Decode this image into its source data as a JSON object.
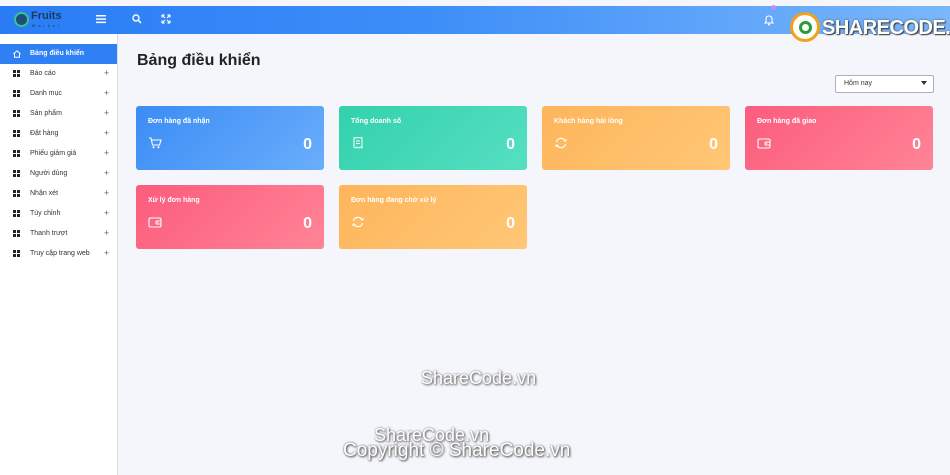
{
  "brand": {
    "name": "Fruits",
    "sub": "Market"
  },
  "header": {
    "menu_icon": "menu-icon",
    "search_icon": "search-icon",
    "fullscreen_icon": "expand-icon",
    "notification_icon": "bell-icon"
  },
  "watermark": {
    "logo_text": "SHARECODE.vn",
    "center_text": "ShareCode.vn",
    "copyright": "Copyright © ShareCode.vn"
  },
  "sidebar": {
    "items": [
      {
        "label": "Bảng điều khiển",
        "icon": "home-icon",
        "active": true
      },
      {
        "label": "Báo cáo",
        "icon": "grid-icon",
        "expand": "+"
      },
      {
        "label": "Danh mục",
        "icon": "grid-icon",
        "expand": "+"
      },
      {
        "label": "Sản phẩm",
        "icon": "grid-icon",
        "expand": "+"
      },
      {
        "label": "Đặt hàng",
        "icon": "grid-icon",
        "expand": "+"
      },
      {
        "label": "Phiếu giảm giá",
        "icon": "grid-icon",
        "expand": "+"
      },
      {
        "label": "Người dùng",
        "icon": "grid-icon",
        "expand": "+"
      },
      {
        "label": "Nhận xét",
        "icon": "grid-icon",
        "expand": "+"
      },
      {
        "label": "Tùy chỉnh",
        "icon": "grid-icon",
        "expand": "+"
      },
      {
        "label": "Thanh trượt",
        "icon": "grid-icon",
        "expand": "+"
      },
      {
        "label": "Truy cập trang web",
        "icon": "grid-icon",
        "expand": "+"
      }
    ]
  },
  "main": {
    "title": "Bảng điều khiển",
    "period_select": {
      "value": "Hôm nay"
    },
    "cards": [
      {
        "title": "Đơn hàng đã nhận",
        "value": "0",
        "icon": "cart-icon",
        "color": "#3b8cf5"
      },
      {
        "title": "Tổng doanh số",
        "value": "0",
        "icon": "receipt-icon",
        "color": "#33d1ad"
      },
      {
        "title": "Khách hàng hài lòng",
        "value": "0",
        "icon": "refresh-icon",
        "color": "#feb55b"
      },
      {
        "title": "Đơn hàng đã giao",
        "value": "0",
        "icon": "wallet-icon",
        "color": "#fc5c7d"
      },
      {
        "title": "Xử lý đơn hàng",
        "value": "0",
        "icon": "wallet-icon",
        "color": "#fc5c7d"
      },
      {
        "title": "Đơn hàng đang chờ xử lý",
        "value": "0",
        "icon": "refresh-icon",
        "color": "#feb55b"
      }
    ]
  }
}
